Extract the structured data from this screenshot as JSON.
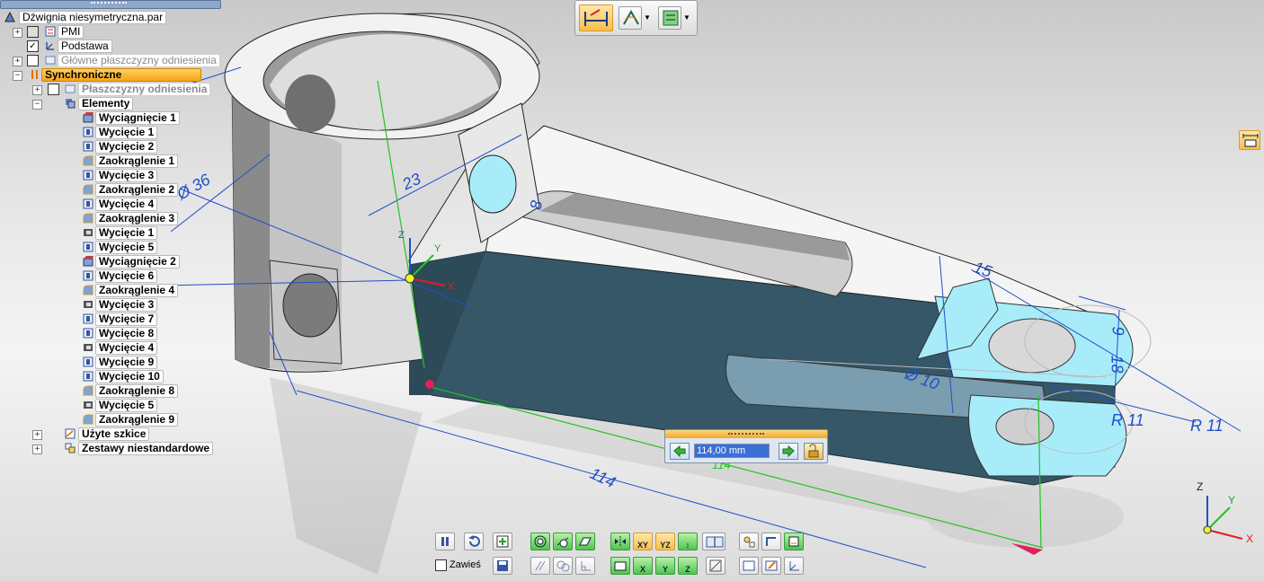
{
  "tree": {
    "document": "Dźwignia niesymetryczna.par",
    "items": [
      {
        "label": "PMI",
        "checked": true,
        "style": "normal"
      },
      {
        "label": "Podstawa",
        "checked": true,
        "style": "normal"
      },
      {
        "label": "Główne płaszczyzny odniesienia",
        "checked": false,
        "style": "grey"
      },
      {
        "label": "Synchroniczne",
        "style": "selected"
      },
      {
        "label": "Płaszczyzny odniesienia",
        "checked": false,
        "style": "grey-bold"
      },
      {
        "label": "Elementy",
        "style": "bold"
      },
      {
        "label": "Wyciągnięcie 1"
      },
      {
        "label": "Wycięcie 1"
      },
      {
        "label": "Wycięcie 2"
      },
      {
        "label": "Zaokrąglenie 1"
      },
      {
        "label": "Wycięcie 3"
      },
      {
        "label": "Zaokrąglenie 2"
      },
      {
        "label": "Wycięcie 4"
      },
      {
        "label": "Zaokrąglenie 3"
      },
      {
        "label": "Wycięcie 1"
      },
      {
        "label": "Wycięcie 5"
      },
      {
        "label": "Wyciągnięcie 2"
      },
      {
        "label": "Wycięcie 6"
      },
      {
        "label": "Zaokrąglenie 4"
      },
      {
        "label": "Wycięcie 3"
      },
      {
        "label": "Wycięcie 7"
      },
      {
        "label": "Wycięcie 8"
      },
      {
        "label": "Wycięcie 4"
      },
      {
        "label": "Wycięcie 9"
      },
      {
        "label": "Wycięcie 10"
      },
      {
        "label": "Zaokrąglenie 8"
      },
      {
        "label": "Wycięcie 5"
      },
      {
        "label": "Zaokrąglenie 9"
      },
      {
        "label": "Użyte szkice",
        "style": "bold"
      },
      {
        "label": "Zestawy niestandardowe",
        "style": "bold"
      }
    ]
  },
  "dimension_edit": {
    "value": "114,00 mm"
  },
  "dimensions": {
    "d36": "Ø 36",
    "d23": "23",
    "d8": "8",
    "d114a": "114",
    "d114b": "114",
    "d15": "15",
    "d9": "9",
    "d18": "18",
    "d10": "Ø 10",
    "r11a": "R 11",
    "r11b": "R 11"
  },
  "axes": {
    "z": "Z",
    "y": "Y",
    "x": "X"
  },
  "bottom_toolbar": {
    "hang_label": "Zawieś"
  },
  "accent_colors": {
    "selection": "#f7a21a",
    "dimension": "#2050c8",
    "face_highlight": "#a8ecfa",
    "green": "#4fc44f"
  }
}
